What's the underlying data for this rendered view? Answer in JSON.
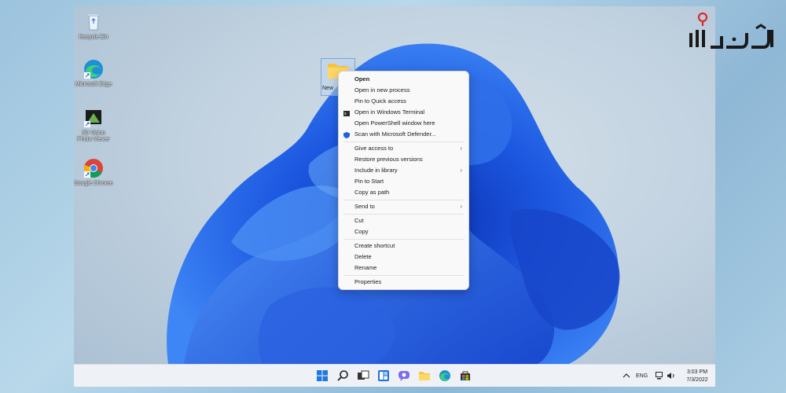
{
  "desktop": {
    "icons": [
      {
        "label": "Recycle Bin"
      },
      {
        "label": "Microsoft Edge"
      },
      {
        "label": "3D Vision Photo Viewer"
      },
      {
        "label": "Google Chrome"
      }
    ],
    "selected_folder_label": "New"
  },
  "context_menu": {
    "items": [
      {
        "label": "Open",
        "bold": true
      },
      {
        "label": "Open in new process"
      },
      {
        "label": "Pin to Quick access"
      },
      {
        "label": "Open in Windows Terminal",
        "icon": "terminal-icon"
      },
      {
        "label": "Open PowerShell window here"
      },
      {
        "label": "Scan with Microsoft Defender...",
        "icon": "defender-shield-icon"
      },
      {
        "label": "Give access to",
        "submenu": true
      },
      {
        "label": "Restore previous versions"
      },
      {
        "label": "Include in library",
        "submenu": true
      },
      {
        "label": "Pin to Start"
      },
      {
        "label": "Copy as path"
      },
      {
        "label": "Send to",
        "submenu": true
      },
      {
        "label": "Cut"
      },
      {
        "label": "Copy"
      },
      {
        "label": "Create shortcut"
      },
      {
        "label": "Delete"
      },
      {
        "label": "Rename"
      },
      {
        "label": "Properties"
      }
    ]
  },
  "taskbar": {
    "apps": [
      "start-icon",
      "search-icon",
      "task-view-icon",
      "widgets-icon",
      "chat-icon",
      "file-explorer-icon",
      "edge-icon",
      "store-icon"
    ],
    "tray": {
      "language": "ENG",
      "time": "3:03 PM",
      "date": "7/3/2022"
    }
  },
  "colors": {
    "accent": "#1f5fe0",
    "taskbar": "#eef2f6",
    "menu_bg": "#f9f9f9"
  }
}
